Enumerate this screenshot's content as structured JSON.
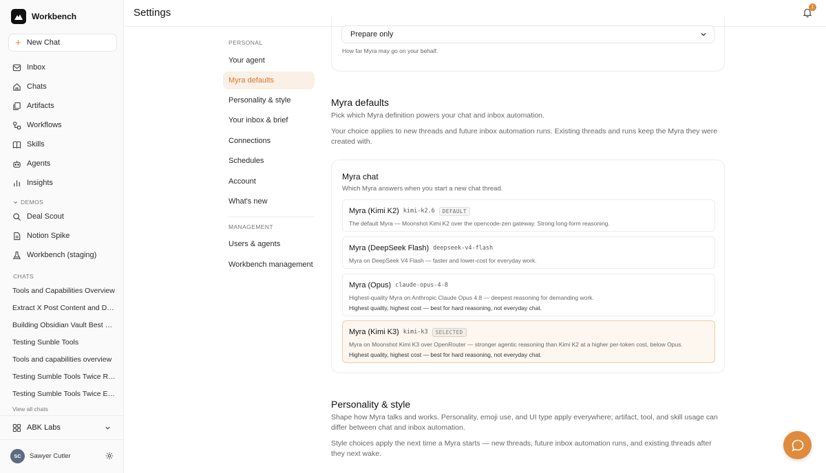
{
  "app": {
    "name": "Workbench"
  },
  "sidebar": {
    "new_chat": "New Chat",
    "nav": [
      {
        "label": "Inbox",
        "icon": "inbox-icon"
      },
      {
        "label": "Chats",
        "icon": "home-icon"
      },
      {
        "label": "Artifacts",
        "icon": "artifacts-icon"
      },
      {
        "label": "Workflows",
        "icon": "workflow-icon"
      },
      {
        "label": "Skills",
        "icon": "book-icon"
      },
      {
        "label": "Agents",
        "icon": "robot-icon"
      },
      {
        "label": "Insights",
        "icon": "bar-chart-icon"
      }
    ],
    "demos_label": "DEMOS",
    "demos": [
      {
        "label": "Deal Scout",
        "icon": "search-icon"
      },
      {
        "label": "Notion Spike",
        "icon": "document-icon"
      },
      {
        "label": "Workbench (staging)",
        "icon": "flask-icon"
      }
    ],
    "chats_label": "CHATS",
    "chats": [
      "Tools and Capabilities Overview",
      "Extract X Post Content and De...",
      "Building Obsidian Vault Best Pr...",
      "Testing Sunble Tools",
      "Tools and capabilities overview",
      "Testing Sumble Tools Twice Re...",
      "Testing Sumble Tools Twice Ea..."
    ],
    "view_all": "View all chats",
    "org": "ABK Labs",
    "user": {
      "initials": "SC",
      "name": "Sawyer Cutler"
    }
  },
  "header": {
    "title": "Settings",
    "notification_count": "1"
  },
  "settings_nav": {
    "personal_label": "PERSONAL",
    "personal": [
      "Your agent",
      "Myra defaults",
      "Personality & style",
      "Your inbox & brief",
      "Connections",
      "Schedules",
      "Account",
      "What's new"
    ],
    "active": "Myra defaults",
    "management_label": "MANAGEMENT",
    "management": [
      "Users & agents",
      "Workbench management"
    ]
  },
  "autonomy": {
    "value": "Prepare only",
    "hint": "How far Myra may go on your behalf."
  },
  "myra_defaults": {
    "title": "Myra defaults",
    "desc1": "Pick which Myra definition powers your chat and inbox automation.",
    "desc2": "Your choice applies to new threads and future inbox automation runs. Existing threads and runs keep the Myra they were created with.",
    "chat": {
      "title": "Myra chat",
      "subtitle": "Which Myra answers when you start a new chat thread.",
      "options": [
        {
          "name": "Myra (Kimi K2)",
          "code": "kimi-k2.6",
          "badge": "DEFAULT",
          "desc": "The default Myra — Moonshot Kimi K2 over the opencode-zen gateway. Strong long-form reasoning.",
          "note": ""
        },
        {
          "name": "Myra (DeepSeek Flash)",
          "code": "deepseek-v4-flash",
          "badge": "",
          "desc": "Myra on DeepSeek V4 Flash — faster and lower-cost for everyday work.",
          "note": ""
        },
        {
          "name": "Myra (Opus)",
          "code": "claude-opus-4-8",
          "badge": "",
          "desc": "Highest-quality Myra on Anthropic Claude Opus 4.8 — deepest reasoning for demanding work.",
          "note": "Highest quality, highest cost — best for hard reasoning, not everyday chat."
        },
        {
          "name": "Myra (Kimi K3)",
          "code": "kimi-k3",
          "badge": "SELECTED",
          "desc": "Myra on Moonshot Kimi K3 over OpenRouter — stronger agentic reasoning than Kimi K2 at a higher per-token cost, below Opus.",
          "note": "Highest quality, highest cost — best for hard reasoning, not everyday chat."
        }
      ]
    }
  },
  "personality": {
    "title": "Personality & style",
    "desc1": "Shape how Myra talks and works. Personality, emoji use, and UI type apply everywhere; artifact, tool, and skill usage can differ between chat and inbox automation.",
    "desc2": "Style choices apply the next time a Myra starts — new threads, future inbox automation runs, and existing threads after they next wake."
  },
  "colors": {
    "accent": "#e08a3c",
    "active_bg": "#fbf0e6",
    "active_text": "#d9742c"
  }
}
